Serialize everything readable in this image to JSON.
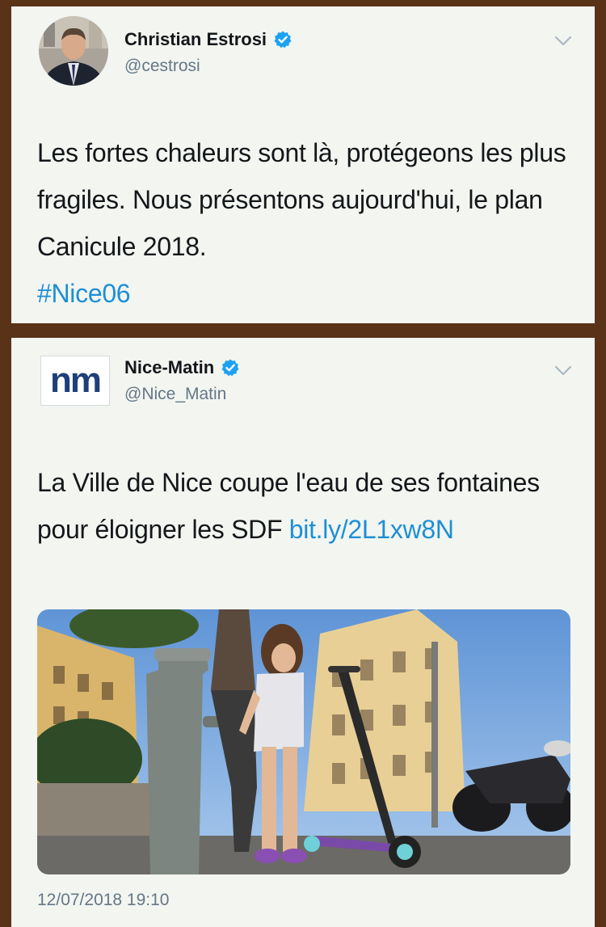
{
  "tweet1": {
    "name": "Christian Estrosi",
    "handle": "@cestrosi",
    "text": "Les fortes chaleurs sont là, protégeons les plus fragiles. Nous présentons aujourd'hui, le plan Canicule 2018.",
    "hashtag": "#Nice06"
  },
  "tweet2": {
    "name": "Nice-Matin",
    "handle": "@Nice_Matin",
    "logo_text": "nm",
    "text": "La Ville de Nice coupe l'eau de ses fontaines pour éloigner les SDF ",
    "link_text": "bit.ly/2L1xw8N",
    "timestamp": "12/07/2018 19:10"
  },
  "colors": {
    "background": "#5a3218",
    "card": "#f3f5f1",
    "link": "#1d8fd6",
    "verified": "#1da1f2",
    "nm_logo": "#1f3f7a"
  },
  "icons": {
    "verified": "verified-badge-icon",
    "chevron": "chevron-down-icon"
  }
}
